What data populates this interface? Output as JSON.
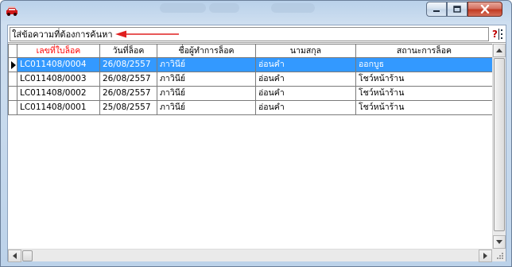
{
  "window": {
    "title_blurred": true
  },
  "search": {
    "value": "ใส่ข้อความที่ต้องการค้นหา",
    "help_glyph": "?",
    "annotation_arrow_color": "#e02020"
  },
  "grid": {
    "columns": [
      {
        "label": "เลขที่ใบล็อค",
        "color": "#ff0000"
      },
      {
        "label": "วันที่ล็อค",
        "color": "#000000"
      },
      {
        "label": "ชื่อผู้ทำการล็อค",
        "color": "#000000"
      },
      {
        "label": "นามสกุล",
        "color": "#000000"
      },
      {
        "label": "สถานะการล็อค",
        "color": "#000000"
      }
    ],
    "rows": [
      {
        "cells": [
          "LC011408/0004",
          "26/08/2557",
          "ภาวินีย์",
          "อ่อนคำ",
          "ออกบูธ"
        ],
        "selected": true
      },
      {
        "cells": [
          "LC011408/0003",
          "26/08/2557",
          "ภาวินีย์",
          "อ่อนคำ",
          "โชว์หน้าร้าน"
        ],
        "selected": false
      },
      {
        "cells": [
          "LC011408/0002",
          "26/08/2557",
          "ภาวินีย์",
          "อ่อนคำ",
          "โชว์หน้าร้าน"
        ],
        "selected": false
      },
      {
        "cells": [
          "LC011408/0001",
          "25/08/2557",
          "ภาวินีย์",
          "อ่อนคำ",
          "โชว์หน้าร้าน"
        ],
        "selected": false
      }
    ],
    "selection_color": "#3399ff"
  },
  "icons": {
    "app": "car-icon",
    "minimize": "minimize-icon",
    "maximize": "maximize-icon",
    "close": "close-icon",
    "help": "help-icon",
    "more": "dots-icon"
  }
}
